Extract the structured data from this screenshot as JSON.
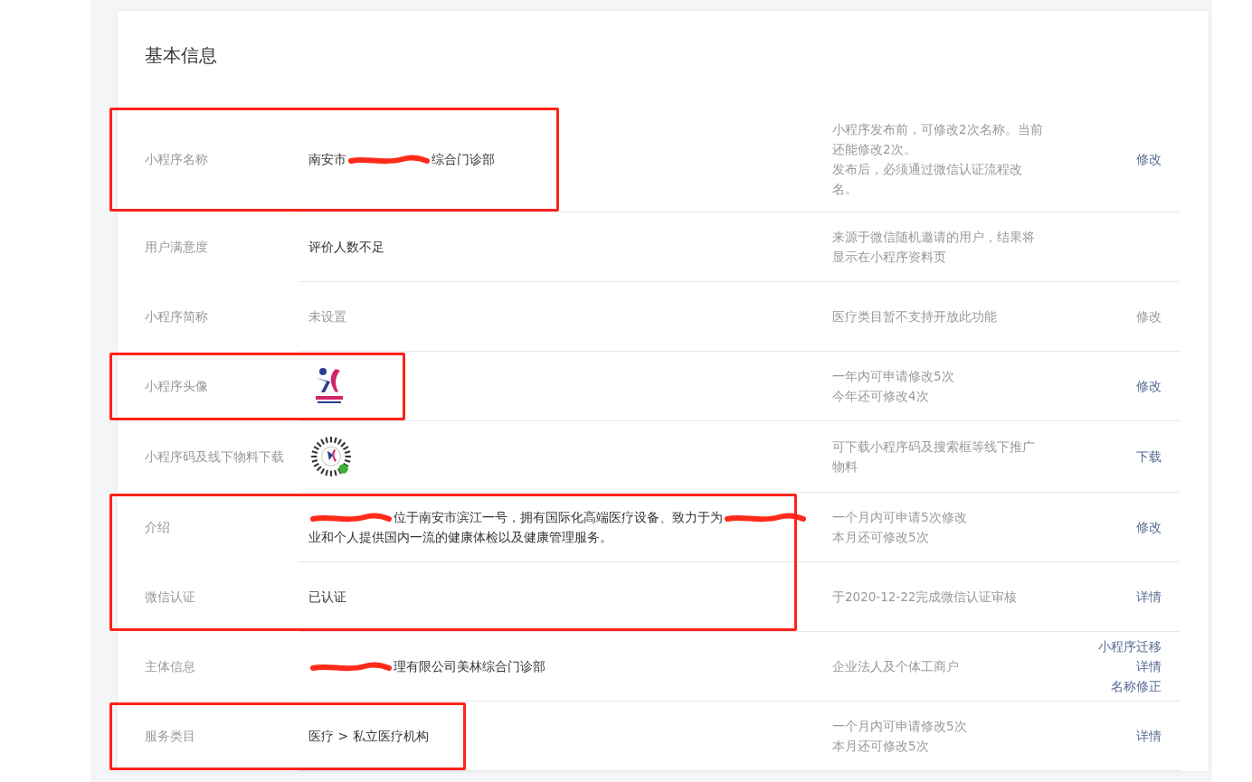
{
  "title": "基本信息",
  "rows": [
    {
      "label": "小程序名称",
      "kind": "text",
      "circled": true,
      "value_parts": [
        {
          "kind": "text",
          "text": "南安市"
        },
        {
          "kind": "redaction"
        },
        {
          "kind": "text",
          "text": "综合门诊部"
        }
      ],
      "muted": false,
      "description": [
        "小程序发布前，可修改2次名称。当前",
        "还能修改2次。",
        "发布后，必须通过微信认证流程改",
        "名。"
      ],
      "actions": [
        "修改"
      ],
      "actions_disabled": false
    },
    {
      "label": "用户满意度",
      "kind": "text",
      "circled": false,
      "value_parts": [
        {
          "kind": "text",
          "text": "评价人数不足"
        }
      ],
      "muted": false,
      "description": [
        "来源于微信随机邀请的用户，结果将",
        "显示在小程序资料页"
      ]
    },
    {
      "label": "小程序简称",
      "kind": "text",
      "circled": false,
      "value_parts": [
        {
          "kind": "text",
          "text": "未设置"
        }
      ],
      "muted": true,
      "description": [
        "医疗类目暂不支持开放此功能"
      ],
      "actions": [
        "修改"
      ],
      "actions_disabled": true
    },
    {
      "label": "小程序头像",
      "kind": "avatar",
      "circled": true,
      "description": [
        "一年内可申请修改5次",
        "今年还可修改4次"
      ],
      "actions": [
        "修改"
      ],
      "actions_disabled": false
    },
    {
      "label": "小程序码及线下物料下载",
      "kind": "qrcode",
      "circled": false,
      "description": [
        "可下载小程序码及搜索框等线下推广",
        "物料"
      ],
      "actions": [
        "下载"
      ],
      "actions_disabled": false
    },
    {
      "label": "介绍",
      "kind": "text",
      "circled": true,
      "value_parts": [
        {
          "kind": "redaction"
        },
        {
          "kind": "text",
          "text": "位于南安市滨江一号，拥有国际化高端医疗设备、致力于为"
        },
        {
          "kind": "redaction"
        },
        {
          "kind": "text",
          "text": "业和个人提供国内一流的健康体检以及健康管理服务。"
        }
      ],
      "muted": false,
      "description": [
        "一个月内可申请5次修改",
        "本月还可修改5次"
      ],
      "actions": [
        "修改"
      ],
      "actions_disabled": false
    },
    {
      "label": "微信认证",
      "kind": "text",
      "circled": true,
      "value_parts": [
        {
          "kind": "text",
          "text": "已认证"
        }
      ],
      "muted": false,
      "description": [
        "于2020-12-22完成微信认证审核"
      ],
      "actions": [
        "详情"
      ],
      "actions_disabled": false
    },
    {
      "label": "主体信息",
      "kind": "text",
      "circled": false,
      "value_parts": [
        {
          "kind": "redaction"
        },
        {
          "kind": "text",
          "text": "理有限公司美林综合门诊部"
        }
      ],
      "muted": false,
      "description": [
        "企业法人及个体工商户"
      ],
      "actions": [
        "小程序迁移",
        "详情",
        "名称修正"
      ],
      "actions_disabled": false
    },
    {
      "label": "服务类目",
      "kind": "text",
      "circled": true,
      "value_parts": [
        {
          "kind": "text",
          "text": "医疗 > 私立医疗机构"
        }
      ],
      "muted": false,
      "description": [
        "一个月内可申请修改5次",
        "本月还可修改5次"
      ],
      "actions": [
        "详情"
      ],
      "actions_disabled": false
    }
  ]
}
